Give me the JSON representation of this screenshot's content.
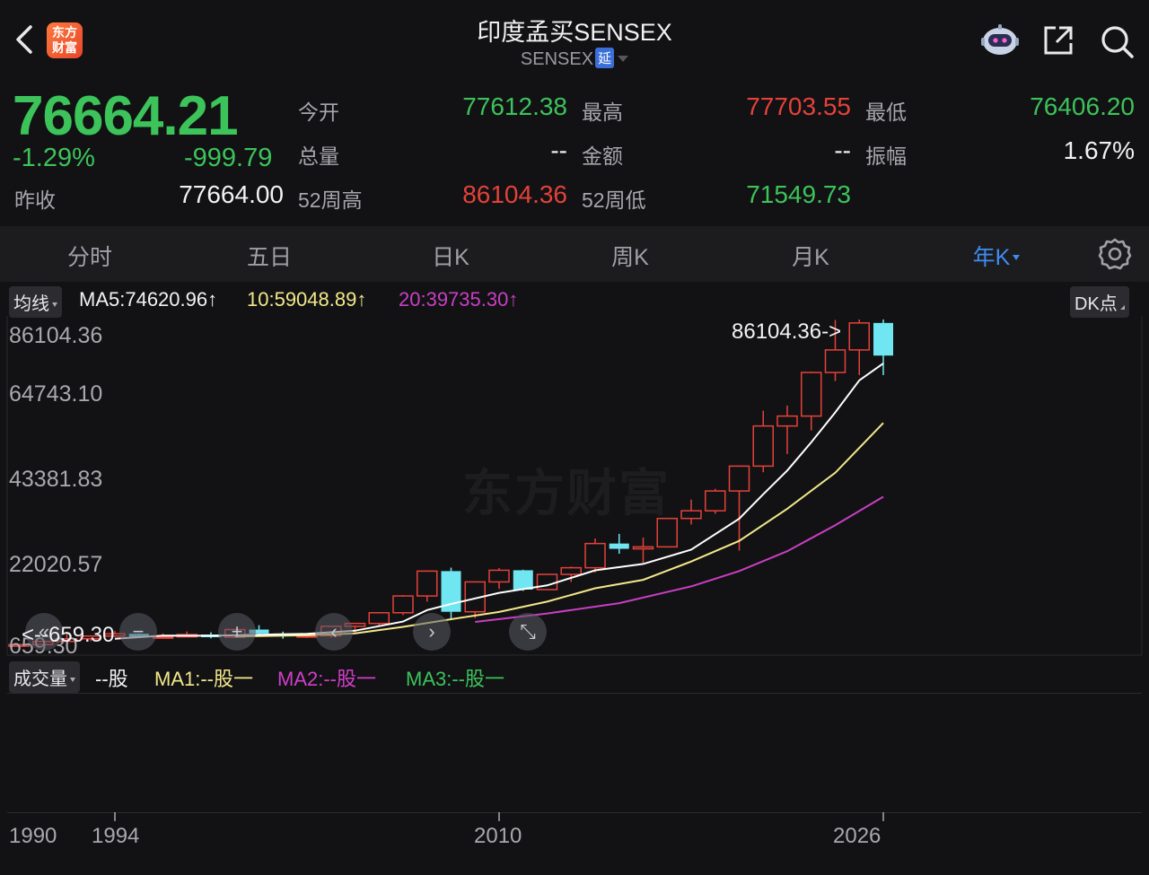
{
  "header": {
    "title": "印度孟买SENSEX",
    "code": "SENSEX",
    "delay_badge": "延",
    "logo_text": [
      "东方",
      "财富"
    ]
  },
  "quote": {
    "price": "76664.21",
    "change_pct": "-1.29%",
    "change": "-999.79",
    "prev_close_label": "昨收",
    "prev_close": "77664.00",
    "open_label": "今开",
    "open": "77612.38",
    "high_label": "最高",
    "high": "77703.55",
    "low_label": "最低",
    "low": "76406.20",
    "volume_label": "总量",
    "volume": "--",
    "amount_label": "金额",
    "amount": "--",
    "amplitude_label": "振幅",
    "amplitude": "1.67%",
    "w52_high_label": "52周高",
    "w52_high": "86104.36",
    "w52_low_label": "52周低",
    "w52_low": "71549.73"
  },
  "tabs": [
    {
      "label": "分时"
    },
    {
      "label": "五日"
    },
    {
      "label": "日K"
    },
    {
      "label": "周K"
    },
    {
      "label": "月K"
    },
    {
      "label": "年K",
      "active": true
    }
  ],
  "ma": {
    "chip": "均线",
    "ma5": "MA5:74620.96↑",
    "ma10": "10:59048.89↑",
    "ma20": "20:39735.30↑",
    "dk_chip": "DK点"
  },
  "price_axis": [
    "86104.36",
    "64743.10",
    "43381.83",
    "22020.57",
    "659.30"
  ],
  "annotations": {
    "high": "86104.36->",
    "low": "<--659.30"
  },
  "watermark": "东方财富",
  "volume": {
    "chip": "成交量",
    "unit": "--股",
    "ma1": "MA1:--股一",
    "ma2": "MA2:--股一",
    "ma3": "MA3:--股一"
  },
  "x_axis": [
    "1990",
    "1994",
    "2010",
    "2026"
  ],
  "colors": {
    "up": "#e5413a",
    "down": "#6fe6f2",
    "ma5": "#ffffff",
    "ma10": "#f3e88a",
    "ma20": "#c93fc3",
    "active_tab": "#3e8cf0"
  },
  "chart_data": {
    "type": "candlestick",
    "period": "yearly",
    "ylim": [
      659.3,
      86104.36
    ],
    "candles": [
      {
        "year": 1990,
        "open": 660,
        "close": 1050,
        "high": 1200,
        "low": 659.3
      },
      {
        "year": 1991,
        "open": 1050,
        "close": 1900,
        "high": 2000,
        "low": 950
      },
      {
        "year": 1992,
        "open": 1900,
        "close": 2600,
        "high": 4400,
        "low": 1800
      },
      {
        "year": 1993,
        "open": 2600,
        "close": 3300,
        "high": 3500,
        "low": 2000
      },
      {
        "year": 1994,
        "open": 3300,
        "close": 3900,
        "high": 4600,
        "low": 3100
      },
      {
        "year": 1995,
        "open": 3900,
        "close": 3100,
        "high": 4000,
        "low": 2900
      },
      {
        "year": 1996,
        "open": 3100,
        "close": 3100,
        "high": 4000,
        "low": 2700
      },
      {
        "year": 1997,
        "open": 3100,
        "close": 3700,
        "high": 4500,
        "low": 3000
      },
      {
        "year": 1998,
        "open": 3700,
        "close": 3000,
        "high": 4300,
        "low": 2700
      },
      {
        "year": 1999,
        "open": 3000,
        "close": 5000,
        "high": 5150,
        "low": 2950
      },
      {
        "year": 2000,
        "open": 5000,
        "close": 3970,
        "high": 6150,
        "low": 3500
      },
      {
        "year": 2001,
        "open": 3970,
        "close": 3260,
        "high": 4460,
        "low": 2600
      },
      {
        "year": 2002,
        "open": 3260,
        "close": 3380,
        "high": 3760,
        "low": 2830
      },
      {
        "year": 2003,
        "open": 3380,
        "close": 5840,
        "high": 5920,
        "low": 2900
      },
      {
        "year": 2004,
        "open": 5840,
        "close": 6600,
        "high": 6650,
        "low": 4230
      },
      {
        "year": 2005,
        "open": 6600,
        "close": 9400,
        "high": 9440,
        "low": 6070
      },
      {
        "year": 2006,
        "open": 9400,
        "close": 13790,
        "high": 14040,
        "low": 8800
      },
      {
        "year": 2007,
        "open": 13790,
        "close": 20290,
        "high": 20500,
        "low": 12300
      },
      {
        "year": 2008,
        "open": 20290,
        "close": 9650,
        "high": 21200,
        "low": 7700
      },
      {
        "year": 2009,
        "open": 9650,
        "close": 17460,
        "high": 17530,
        "low": 8000
      },
      {
        "year": 2010,
        "open": 17460,
        "close": 20510,
        "high": 21100,
        "low": 15650
      },
      {
        "year": 2011,
        "open": 20510,
        "close": 15450,
        "high": 20660,
        "low": 15140
      },
      {
        "year": 2012,
        "open": 15450,
        "close": 19430,
        "high": 19610,
        "low": 15360
      },
      {
        "year": 2013,
        "open": 19430,
        "close": 21170,
        "high": 21480,
        "low": 17450
      },
      {
        "year": 2014,
        "open": 21170,
        "close": 27500,
        "high": 28820,
        "low": 19960
      },
      {
        "year": 2015,
        "open": 27500,
        "close": 26120,
        "high": 30020,
        "low": 24830
      },
      {
        "year": 2016,
        "open": 26120,
        "close": 26630,
        "high": 29080,
        "low": 22490
      },
      {
        "year": 2017,
        "open": 26630,
        "close": 34060,
        "high": 34140,
        "low": 26450
      },
      {
        "year": 2018,
        "open": 34060,
        "close": 36070,
        "high": 38990,
        "low": 32480
      },
      {
        "year": 2019,
        "open": 36070,
        "close": 41250,
        "high": 41810,
        "low": 35290
      },
      {
        "year": 2020,
        "open": 41250,
        "close": 47750,
        "high": 47900,
        "low": 25640
      },
      {
        "year": 2021,
        "open": 47750,
        "close": 58250,
        "high": 62250,
        "low": 46160
      },
      {
        "year": 2022,
        "open": 58250,
        "close": 60840,
        "high": 63580,
        "low": 50920
      },
      {
        "year": 2023,
        "open": 60840,
        "close": 72240,
        "high": 72480,
        "low": 57080
      },
      {
        "year": 2024,
        "open": 72240,
        "close": 78140,
        "high": 85980,
        "low": 70000
      },
      {
        "year": 2025,
        "open": 78140,
        "close": 85200,
        "high": 86104.36,
        "low": 71550
      },
      {
        "year": 2026,
        "open": 85200,
        "close": 76664.21,
        "high": 86104.36,
        "low": 71549.73
      }
    ],
    "ma5": [
      [
        1994,
        2600
      ],
      [
        1996,
        3400
      ],
      [
        1998,
        3380
      ],
      [
        2000,
        3650
      ],
      [
        2002,
        3880
      ],
      [
        2004,
        4700
      ],
      [
        2006,
        7100
      ],
      [
        2007,
        10100
      ],
      [
        2008,
        11700
      ],
      [
        2010,
        14600
      ],
      [
        2012,
        16550
      ],
      [
        2014,
        20500
      ],
      [
        2016,
        22150
      ],
      [
        2018,
        25900
      ],
      [
        2020,
        34000
      ],
      [
        2021,
        40400
      ],
      [
        2022,
        46600
      ],
      [
        2023,
        54000
      ],
      [
        2024,
        61800
      ],
      [
        2025,
        70200
      ],
      [
        2026,
        74620.96
      ]
    ],
    "ma10": [
      [
        1999,
        3200
      ],
      [
        2002,
        3500
      ],
      [
        2004,
        4000
      ],
      [
        2006,
        5700
      ],
      [
        2008,
        7700
      ],
      [
        2010,
        9600
      ],
      [
        2012,
        12300
      ],
      [
        2014,
        15800
      ],
      [
        2016,
        18000
      ],
      [
        2018,
        22800
      ],
      [
        2020,
        28200
      ],
      [
        2022,
        36600
      ],
      [
        2024,
        46000
      ],
      [
        2026,
        59048.89
      ]
    ],
    "ma20": [
      [
        2009,
        7000
      ],
      [
        2012,
        9200
      ],
      [
        2015,
        11900
      ],
      [
        2018,
        16300
      ],
      [
        2020,
        20300
      ],
      [
        2022,
        25500
      ],
      [
        2024,
        32300
      ],
      [
        2026,
        39735.3
      ]
    ]
  }
}
